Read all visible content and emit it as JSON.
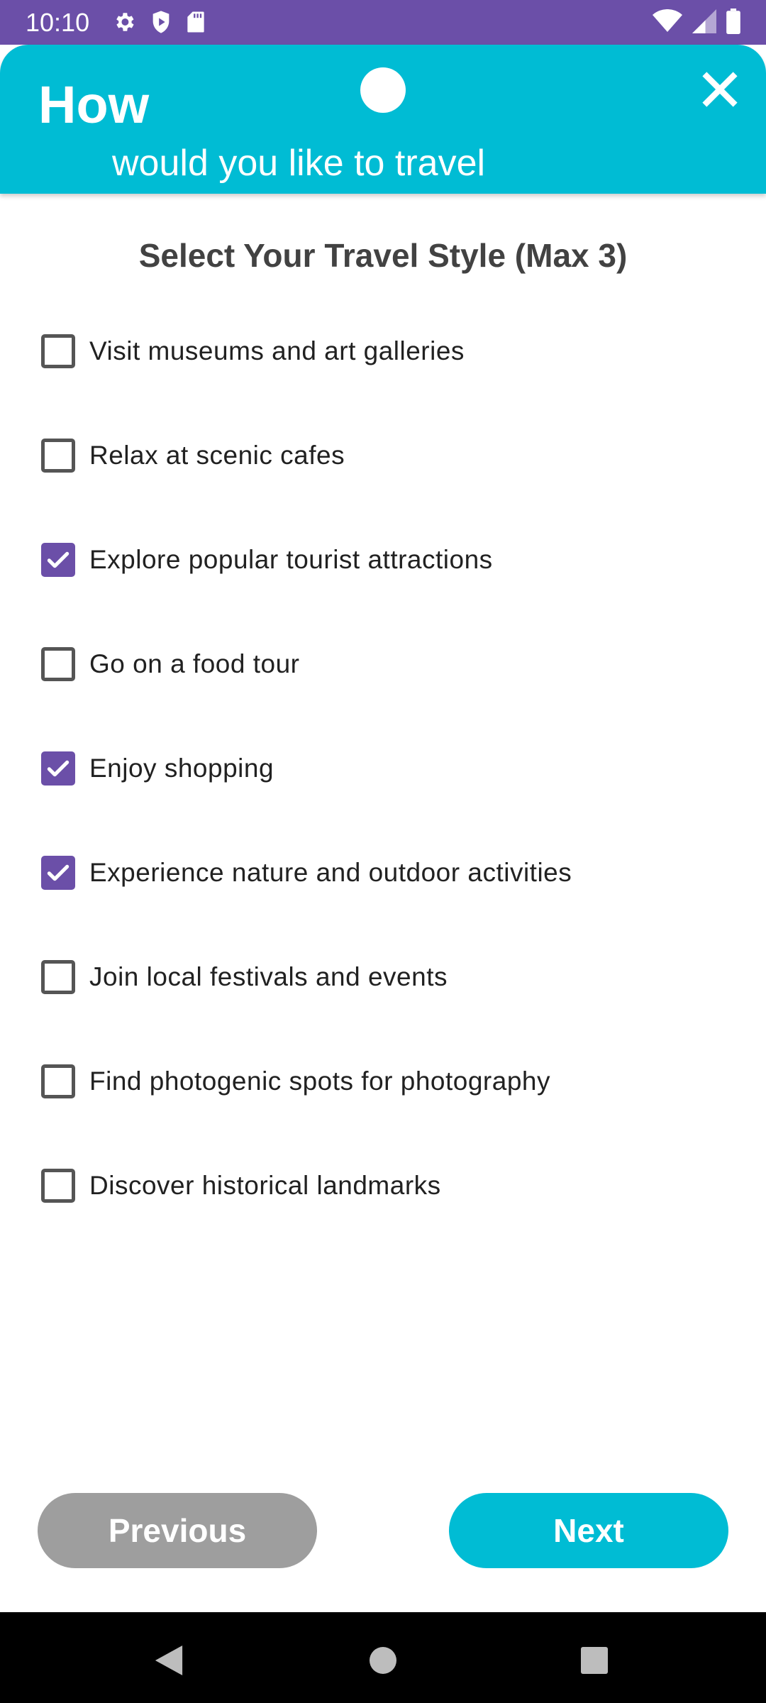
{
  "status_bar": {
    "time": "10:10",
    "left_icons": [
      "gear-icon",
      "shield-icon",
      "sd-card-icon"
    ],
    "right_icons": [
      "wifi-icon",
      "signal-icon",
      "battery-icon"
    ],
    "background": "#6B4FA8"
  },
  "header": {
    "title": "How",
    "subtitle": "would you like to travel",
    "close_icon": "close-icon",
    "background": "#00BCD4"
  },
  "content": {
    "section_title": "Select Your Travel Style (Max 3)",
    "options": [
      {
        "label": "Visit museums and art galleries",
        "checked": false
      },
      {
        "label": "Relax at scenic cafes",
        "checked": false
      },
      {
        "label": "Explore popular tourist attractions",
        "checked": true
      },
      {
        "label": "Go on a food tour",
        "checked": false
      },
      {
        "label": "Enjoy shopping",
        "checked": true
      },
      {
        "label": "Experience nature and outdoor activities",
        "checked": true
      },
      {
        "label": "Join local festivals and events",
        "checked": false
      },
      {
        "label": "Find photogenic spots for photography",
        "checked": false
      },
      {
        "label": "Discover historical landmarks",
        "checked": false
      }
    ],
    "checkbox_color": "#6B4FA8"
  },
  "footer": {
    "previous_label": "Previous",
    "next_label": "Next",
    "previous_color": "#9E9E9E",
    "next_color": "#00BCD4"
  },
  "nav_bar": {
    "icons": [
      "back-icon",
      "home-icon",
      "recents-icon"
    ]
  }
}
